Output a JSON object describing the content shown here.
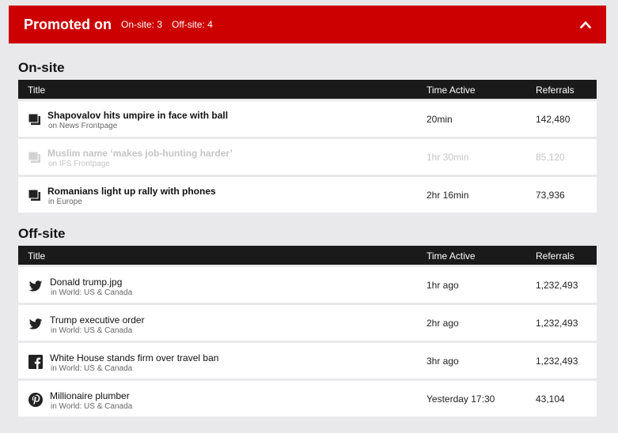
{
  "header": {
    "title": "Promoted on",
    "onsite_count": "On-site: 3",
    "offsite_count": "Off-site: 4"
  },
  "colors": {
    "brand": "#cc0000",
    "table_header": "#1a1a1a",
    "background": "#e9e9ec"
  },
  "onsite": {
    "heading": "On-site",
    "columns": {
      "title": "Title",
      "time": "Time Active",
      "referrals": "Referrals"
    },
    "rows": [
      {
        "title": "Shapovalov hits umpire in face with ball",
        "location": "on News Frontpage",
        "time": "20min",
        "referrals": "142,480",
        "icon": "article-stack-icon",
        "active": true
      },
      {
        "title": "Muslim name ‘makes job-hunting harder’",
        "location": "on IFS Frontpage",
        "time": "1hr 30min",
        "referrals": "85,120",
        "icon": "article-stack-icon",
        "active": false
      },
      {
        "title": "Romanians light up rally with phones",
        "location": "in Europe",
        "time": "2hr 16min",
        "referrals": "73,936",
        "icon": "article-stack-icon",
        "active": true
      }
    ]
  },
  "offsite": {
    "heading": "Off-site",
    "columns": {
      "title": "Title",
      "time": "Time Active",
      "referrals": "Referrals"
    },
    "rows": [
      {
        "title": "Donald trump.jpg",
        "location": "in World: US & Canada",
        "time": "1hr ago",
        "referrals": "1,232,493",
        "icon": "twitter-icon"
      },
      {
        "title": "Trump executive order",
        "location": "in World: US & Canada",
        "time": "2hr ago",
        "referrals": "1,232,493",
        "icon": "twitter-icon"
      },
      {
        "title": "White House stands firm over travel ban",
        "location": "in World: US & Canada",
        "time": "3hr ago",
        "referrals": "1,232,493",
        "icon": "facebook-icon"
      },
      {
        "title": "Millionaire plumber",
        "location": "in World: US & Canada",
        "time": "Yesterday 17:30",
        "referrals": "43,104",
        "icon": "pinterest-icon"
      }
    ]
  }
}
